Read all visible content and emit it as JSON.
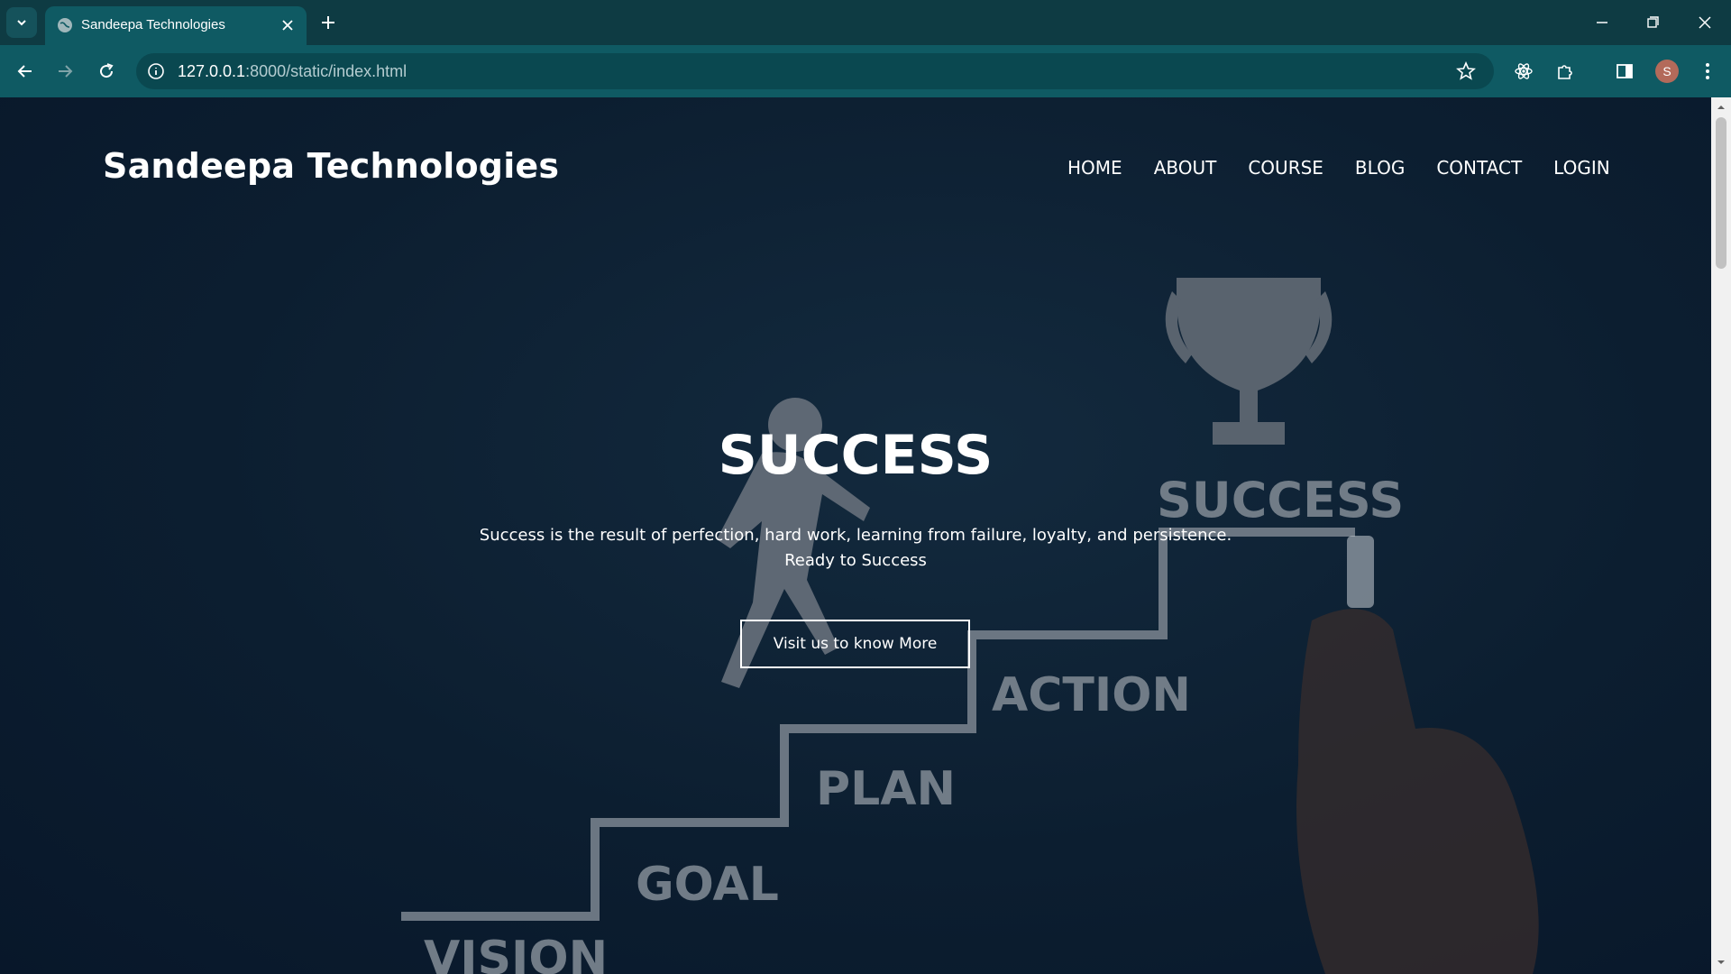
{
  "browser": {
    "tab_title": "Sandeepa Technologies",
    "url_host": "127.0.0.1",
    "url_path": ":8000/static/index.html",
    "profile_initial": "S"
  },
  "site": {
    "brand": "Sandeepa Technologies",
    "nav": [
      "HOME",
      "ABOUT",
      "COURSE",
      "BLOG",
      "CONTACT",
      "LOGIN"
    ]
  },
  "hero": {
    "title": "SUCCESS",
    "line1": "Success is the result of perfection, hard work, learning from failure, loyalty, and persistence.",
    "line2": "Ready to Success",
    "cta": "Visit us to know More"
  },
  "artwork": {
    "labels": [
      "VISION",
      "GOAL",
      "PLAN",
      "ACTION",
      "SUCCESS"
    ]
  },
  "colors": {
    "tab_strip": "#0e3b43",
    "toolbar": "#0f5a63",
    "page_bg": "#0c1e30",
    "chalk": "#7b8793"
  }
}
